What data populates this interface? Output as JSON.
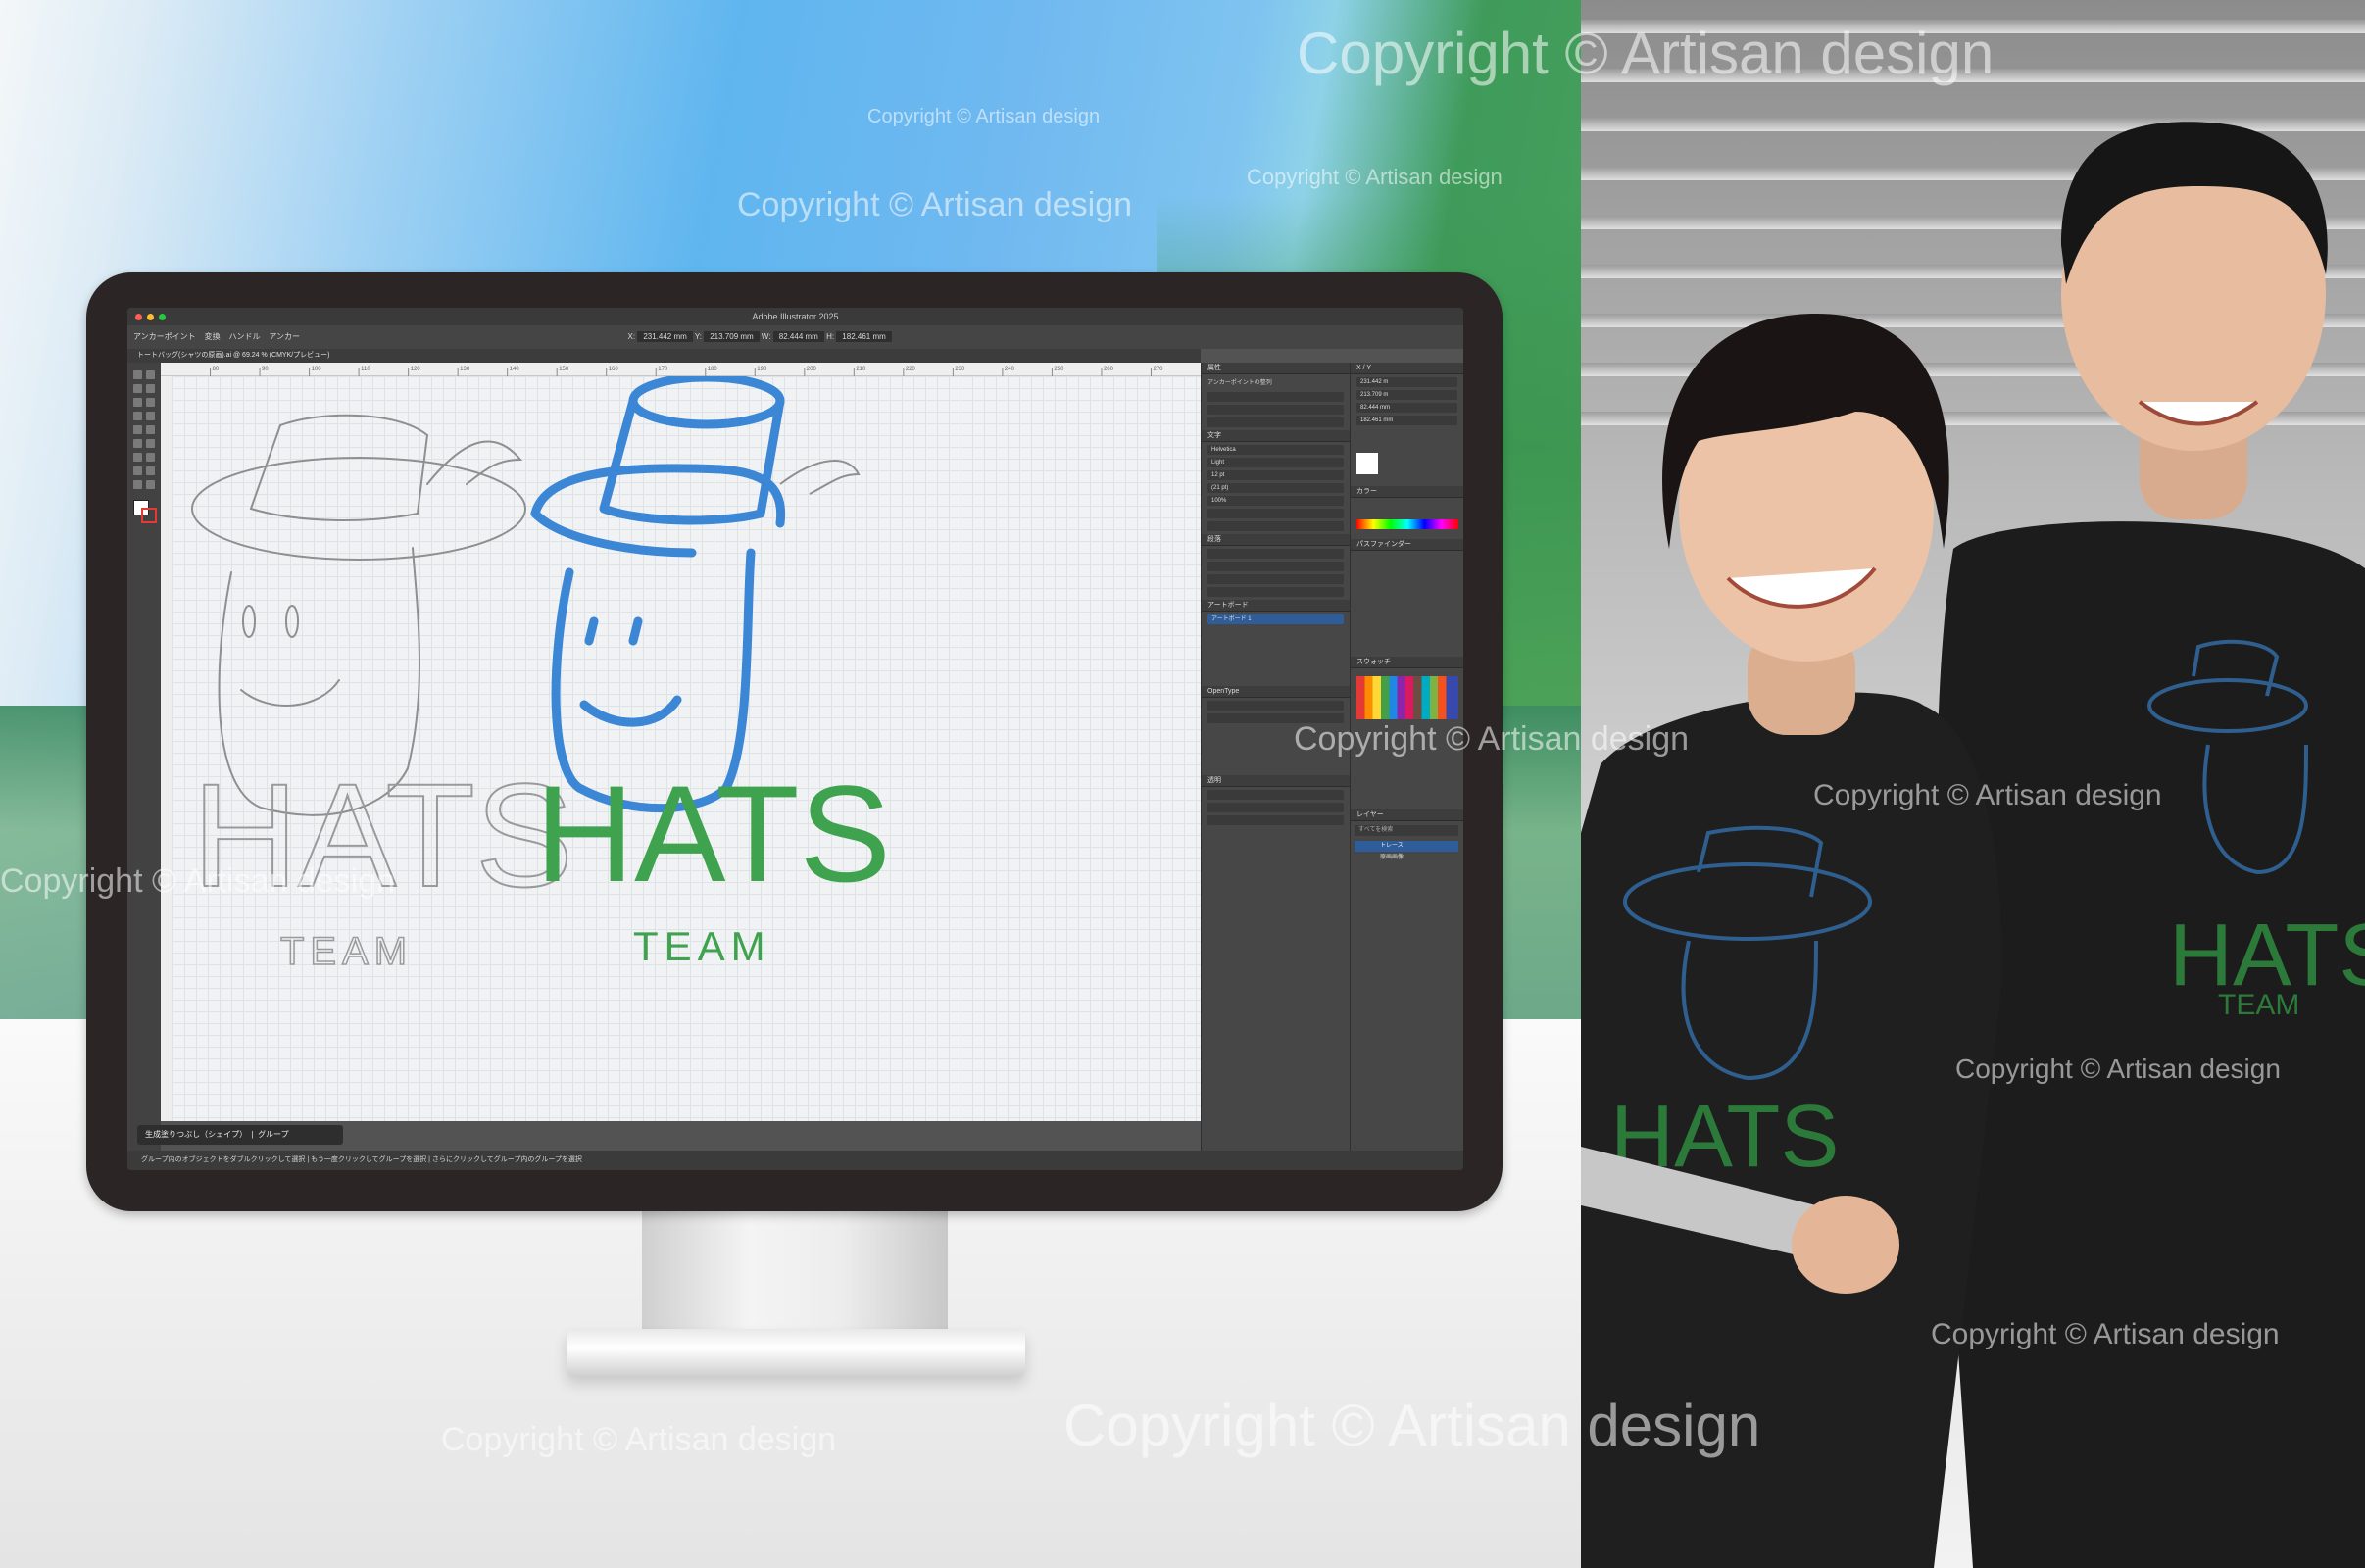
{
  "app": {
    "title": "Adobe Illustrator 2025",
    "document_tab": "トートバッグ(シャツの原画).ai @ 69.24 % (CMYK/プレビュー)"
  },
  "control_bar": {
    "items": [
      "アンカーポイント",
      "変換",
      "ハンドル",
      "アンカー",
      "X:",
      "231.442 mm",
      "Y:",
      "213.709 mm",
      "W:",
      "82.444 mm",
      "H:",
      "182.461 mm"
    ]
  },
  "ruler_ticks": [
    "80",
    "90",
    "100",
    "110",
    "120",
    "130",
    "140",
    "150",
    "160",
    "170",
    "180",
    "190",
    "200",
    "210",
    "220",
    "230",
    "240",
    "250",
    "260",
    "270"
  ],
  "artwork": {
    "sketch_word": "HATS",
    "sketch_sub": "TEAM",
    "vector_word": "HATS",
    "vector_sub": "TEAM",
    "hat_color": "#3b87d6",
    "text_color": "#3fa24f"
  },
  "context_bar": {
    "label": "生成塗りつぶし（シェイプ）",
    "group": "グループ"
  },
  "status_bar": {
    "text": "グループ内のオブジェクトをダブルクリックして選択 | もう一度クリックしてグループを選択 | さらにクリックしてグループ内のグループを選択"
  },
  "panels": {
    "properties": "属性",
    "anchor": "アンカーポイントの整列",
    "character": "文字",
    "font": "Helvetica",
    "weight": "Light",
    "size": "12 pt",
    "leading": "(21 pt)",
    "tracking": "100%",
    "paragraph": "段落",
    "artboard": "アートボード",
    "artboard_item": "アートボード 1",
    "opentype": "OpenType",
    "transparency": "透明",
    "color": "カラー",
    "pathfinder": "パスファインダー",
    "swatches": "スウォッチ",
    "layers": "レイヤー",
    "layer_1": "トレース",
    "layer_2": "原画画像",
    "search_placeholder": "すべてを検索",
    "x_val": "231.442 m",
    "y_val": "213.709 m",
    "w_val": "82.444 mm",
    "h_val": "182.461 mm"
  },
  "shirts": {
    "print_word": "HATS",
    "print_sub": "TEAM"
  },
  "watermarks": [
    "Copyright © Artisan design",
    "Copyright © Artisan design",
    "Copyright © Artisan design",
    "Copyright © Artisan design",
    "Copyright © Artisan design",
    "Copyright © Artisan design",
    "Copyright © Artisan design",
    "Copyright © Artisan design",
    "Copyright © Artisan design",
    "Copyright © Artisan design",
    "Copyright © Artisan design"
  ]
}
